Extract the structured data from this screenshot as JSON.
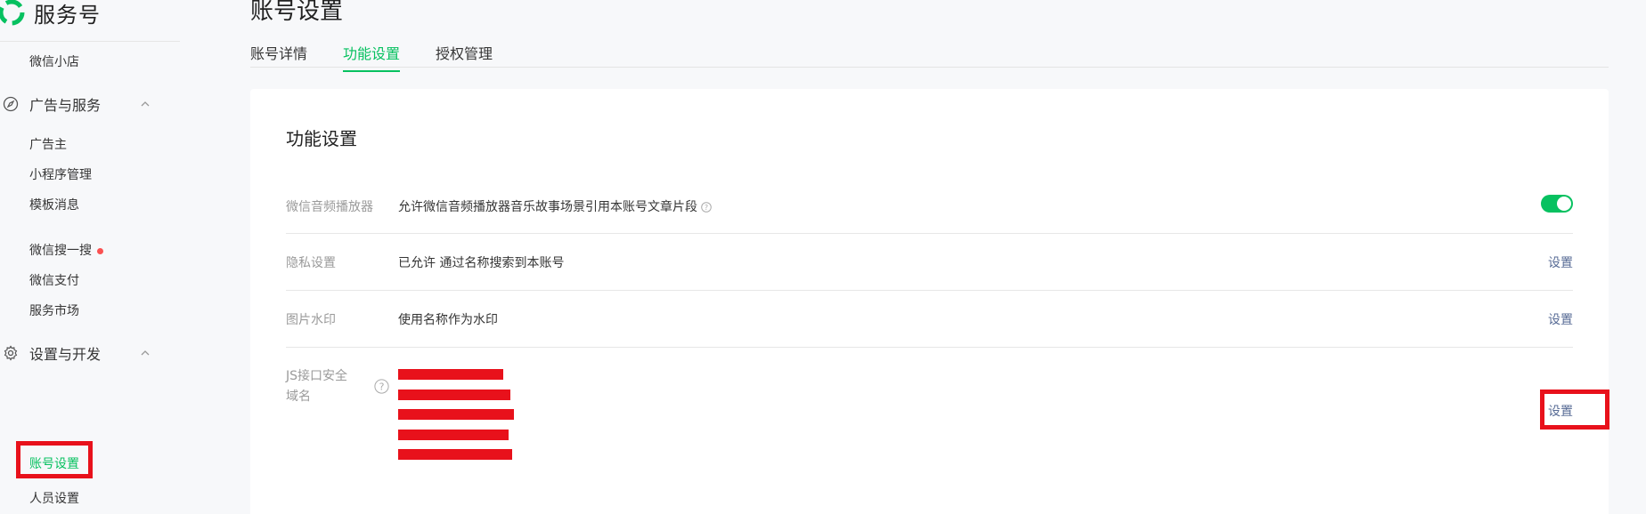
{
  "brand": {
    "name": "服务号"
  },
  "sidebar": {
    "wechat_shop": "微信小店",
    "ads_group": "广告与服务",
    "advertiser": "广告主",
    "miniprogram": "小程序管理",
    "template_msg": "模板消息",
    "search": "微信搜一搜",
    "pay": "微信支付",
    "market": "服务市场",
    "settings_group": "设置与开发",
    "account_settings": "账号设置",
    "member_settings": "人员设置"
  },
  "page": {
    "title": "账号设置",
    "tabs": [
      "账号详情",
      "功能设置",
      "授权管理"
    ],
    "active_tab": "功能设置"
  },
  "card": {
    "title": "功能设置",
    "rows": [
      {
        "label": "微信音频播放器",
        "value": "允许微信音频播放器音乐故事场景引用本账号文章片段",
        "action": ""
      },
      {
        "label": "隐私设置",
        "value": "已允许 通过名称搜索到本账号",
        "action": "设置"
      },
      {
        "label": "图片水印",
        "value": "使用名称作为水印",
        "action": "设置"
      },
      {
        "label": "JS接口安全域名",
        "value": "",
        "action": "设置"
      }
    ],
    "toggle_on": true
  },
  "colors": {
    "accent": "#07c160",
    "highlight": "#e8111b",
    "link": "#576b95"
  }
}
